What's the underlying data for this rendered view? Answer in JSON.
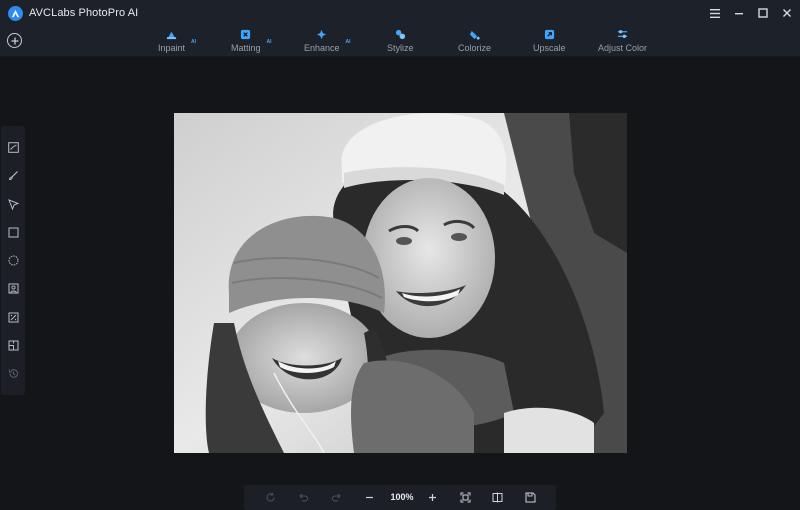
{
  "app": {
    "title": "AVCLabs PhotoPro AI",
    "accent_color": "#2f8bf0"
  },
  "window_controls": [
    {
      "icon": "hamburger-menu-icon"
    },
    {
      "icon": "minimize-icon"
    },
    {
      "icon": "maximize-icon"
    },
    {
      "icon": "close-icon"
    }
  ],
  "toolbar": {
    "add_icon": "plus-circle-icon",
    "tools": [
      {
        "label": "Inpaint",
        "ai": "AI",
        "icon": "inpaint-icon"
      },
      {
        "label": "Matting",
        "ai": "AI",
        "icon": "matting-icon"
      },
      {
        "label": "Enhance",
        "ai": "AI",
        "icon": "enhance-icon"
      },
      {
        "label": "Stylize",
        "ai": "",
        "icon": "stylize-icon"
      },
      {
        "label": "Colorize",
        "ai": "",
        "icon": "colorize-icon"
      },
      {
        "label": "Upscale",
        "ai": "",
        "icon": "upscale-icon"
      },
      {
        "label": "Adjust Color",
        "ai": "",
        "icon": "adjust-color-icon"
      }
    ]
  },
  "left_tools": [
    {
      "icon": "image-edit-icon"
    },
    {
      "icon": "brush-icon"
    },
    {
      "icon": "lasso-select-icon"
    },
    {
      "icon": "rectangle-select-icon"
    },
    {
      "icon": "ellipse-select-icon"
    },
    {
      "icon": "portrait-select-icon"
    },
    {
      "icon": "auto-select-icon"
    },
    {
      "icon": "layers-icon"
    },
    {
      "icon": "history-icon"
    }
  ],
  "bottom_bar": {
    "zoom": "100%",
    "icons": [
      "reset-icon",
      "undo-icon",
      "redo-icon",
      "zoom-out-icon",
      "zoom-in-icon",
      "fit-screen-icon",
      "compare-icon",
      "save-icon"
    ]
  },
  "photo": {
    "description_icon": "photo-canvas"
  }
}
